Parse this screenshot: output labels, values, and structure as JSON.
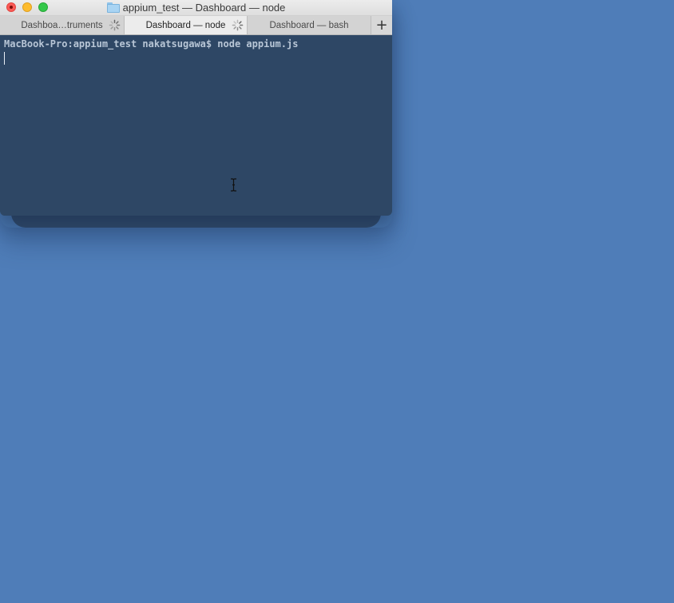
{
  "window": {
    "title": "appium_test — Dashboard — node"
  },
  "tabs": [
    {
      "label": "Dashboa…truments",
      "active": false,
      "busy": true
    },
    {
      "label": "Dashboard — node",
      "active": true,
      "busy": true
    },
    {
      "label": "Dashboard — bash",
      "active": false,
      "busy": false
    }
  ],
  "tab_add_label": "+",
  "terminal": {
    "prompt": "MacBook-Pro:appium_test nakatsugawa$ node appium.js"
  },
  "colors": {
    "desktop": "#4f7db8",
    "terminal_bg": "#2e4765",
    "terminal_text": "#b8c6d6"
  },
  "icons": {
    "close": "close-dot",
    "minimize": "minimize-dot",
    "zoom": "zoom-dot",
    "folder": "folder-icon",
    "spinner": "spinner-icon",
    "cursor": "ibeam-cursor-icon"
  }
}
